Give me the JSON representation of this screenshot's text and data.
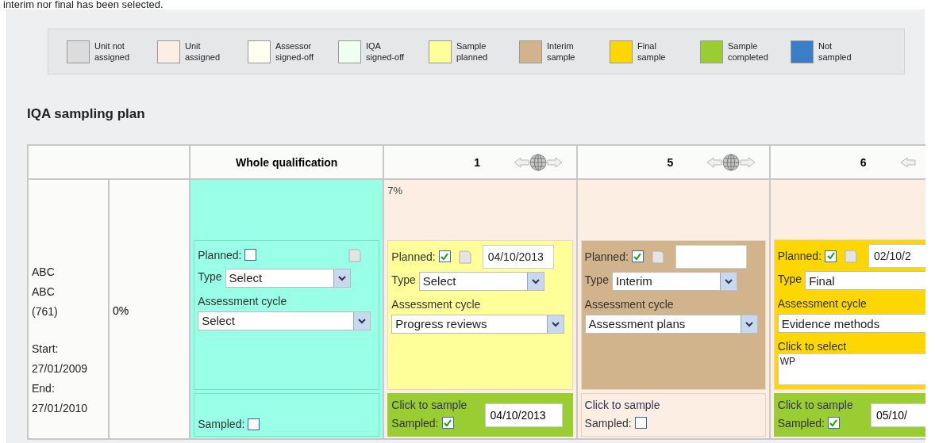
{
  "caption": "interim nor final has been selected.",
  "legend": [
    {
      "label": "Unit not assigned",
      "color": "#dcdcdc"
    },
    {
      "label": "Unit assigned",
      "color": "#fdeee4"
    },
    {
      "label": "Assessor signed-off",
      "color": "#fffff0"
    },
    {
      "label": "IQA signed-off",
      "color": "#f0fff0"
    },
    {
      "label": "Sample planned",
      "color": "#ffff99"
    },
    {
      "label": "Interim sample",
      "color": "#d2b48c"
    },
    {
      "label": "Final sample",
      "color": "#ffd700"
    },
    {
      "label": "Sample completed",
      "color": "#9acd32"
    },
    {
      "label": "Not sampled",
      "color": "#3a7dc9"
    }
  ],
  "title": "IQA sampling plan",
  "table": {
    "columns": [
      {
        "kind": "qualification",
        "label": "Whole qualification"
      },
      {
        "kind": "unit",
        "label": "1",
        "nav_left": true,
        "nav_globe": true,
        "nav_right": true
      },
      {
        "kind": "unit",
        "label": "5",
        "nav_left": true,
        "nav_globe": true,
        "nav_right": true
      },
      {
        "kind": "unit",
        "label": "6",
        "nav_left": true
      }
    ],
    "rows": [
      {
        "learner": {
          "name": "ABC",
          "code": "ABC",
          "id": "(761)",
          "start_label": "Start:",
          "start": "27/01/2009",
          "end_label": "End:",
          "end": "27/01/2010"
        },
        "progress": "0%",
        "cells": [
          {
            "kind": "qualification",
            "plan": {
              "planned_label": "Planned:",
              "planned": false,
              "type_label": "Type",
              "type": "Select",
              "cycle_label": "Assessment cycle",
              "cycle": "Select"
            },
            "sample": {
              "sampled_label": "Sampled:",
              "sampled": false
            }
          },
          {
            "kind": "unit",
            "percent": "7%",
            "plan": {
              "color": "#ffff99",
              "planned_label": "Planned:",
              "planned": true,
              "date": "04/10/2013",
              "type_label": "Type",
              "type": "Select",
              "cycle_label": "Assessment cycle",
              "cycle": "Progress reviews"
            },
            "sample": {
              "completed": true,
              "link": "Click to sample",
              "date": "04/10/2013",
              "sampled_label": "Sampled:",
              "sampled": true
            }
          },
          {
            "kind": "unit",
            "plan": {
              "color": "#d2b48c",
              "planned_label": "Planned:",
              "planned": true,
              "type_label": "Type",
              "type": "Interim",
              "cycle_label": "Assessment cycle",
              "cycle": "Assessment plans"
            },
            "sample": {
              "completed": false,
              "link": "Click to sample",
              "sampled_label": "Sampled:",
              "sampled": false
            }
          },
          {
            "kind": "unit",
            "plan": {
              "color": "#ffd700",
              "planned_label": "Planned:",
              "planned": true,
              "date": "02/10/2",
              "type_label": "Type",
              "type": "Final",
              "cycle_label": "Assessment cycle",
              "cycle": "Evidence methods",
              "methods_label": "Click to select",
              "methods": "WP"
            },
            "sample": {
              "completed": true,
              "link": "Click to sample",
              "date": "05/10/",
              "sampled_label": "Sampled:",
              "sampled": true
            }
          }
        ]
      }
    ]
  }
}
